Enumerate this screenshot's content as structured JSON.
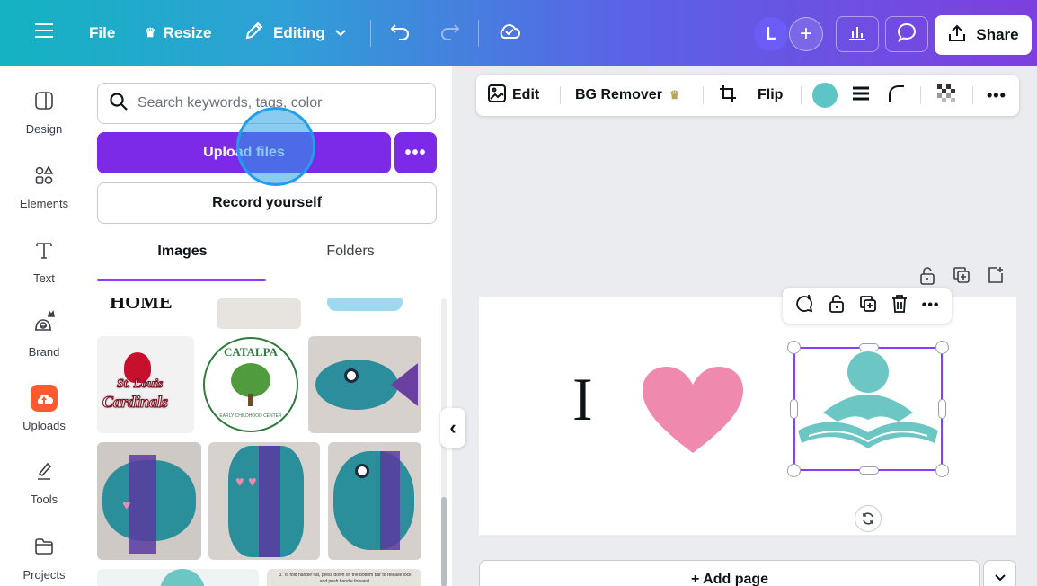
{
  "topbar": {
    "file_label": "File",
    "resize_label": "Resize",
    "editing_label": "Editing",
    "avatar_initial": "L",
    "add_label": "+",
    "share_label": "Share"
  },
  "rail": {
    "items": [
      {
        "label": "Design",
        "icon": "layout-icon"
      },
      {
        "label": "Elements",
        "icon": "shapes-icon"
      },
      {
        "label": "Text",
        "icon": "text-icon"
      },
      {
        "label": "Brand",
        "icon": "brand-icon"
      },
      {
        "label": "Uploads",
        "icon": "cloud-upload-icon"
      },
      {
        "label": "Tools",
        "icon": "pen-tool-icon"
      },
      {
        "label": "Projects",
        "icon": "folder-icon"
      }
    ],
    "active_index": 4,
    "accent": "#ff5b2e"
  },
  "panel": {
    "search_placeholder": "Search keywords, tags, color",
    "upload_label": "Upload files",
    "more_label": "•••",
    "record_label": "Record yourself",
    "tabs": [
      {
        "label": "Images",
        "active": true
      },
      {
        "label": "Folders",
        "active": false
      }
    ],
    "thumb_text": {
      "cardinals_line1": "St. Louis",
      "cardinals_line2": "Cardinals",
      "catalpa": "CATALPA",
      "catalpa_sub": "EARLY CHILDHOOD CENTER",
      "top_left": "HOME",
      "instructions": "3. To fold handle flat, press down on the bottom bar to release lock and push handle forward."
    }
  },
  "context_toolbar": {
    "edit_label": "Edit",
    "bg_remover_label": "BG Remover",
    "flip_label": "Flip",
    "color_swatch": "#5ec4c6",
    "more_label": "•••"
  },
  "canvas": {
    "letter": "I",
    "heart_color": "#ef8aae",
    "reader_color": "#6cc6c4",
    "selection_color": "#8b3dff",
    "add_page_label": "+ Add page"
  },
  "collapse_label": "‹",
  "colors": {
    "brand_purple": "#7d2ae8",
    "gradient_start": "#14b3c2",
    "gradient_end": "#7d3fdf"
  }
}
